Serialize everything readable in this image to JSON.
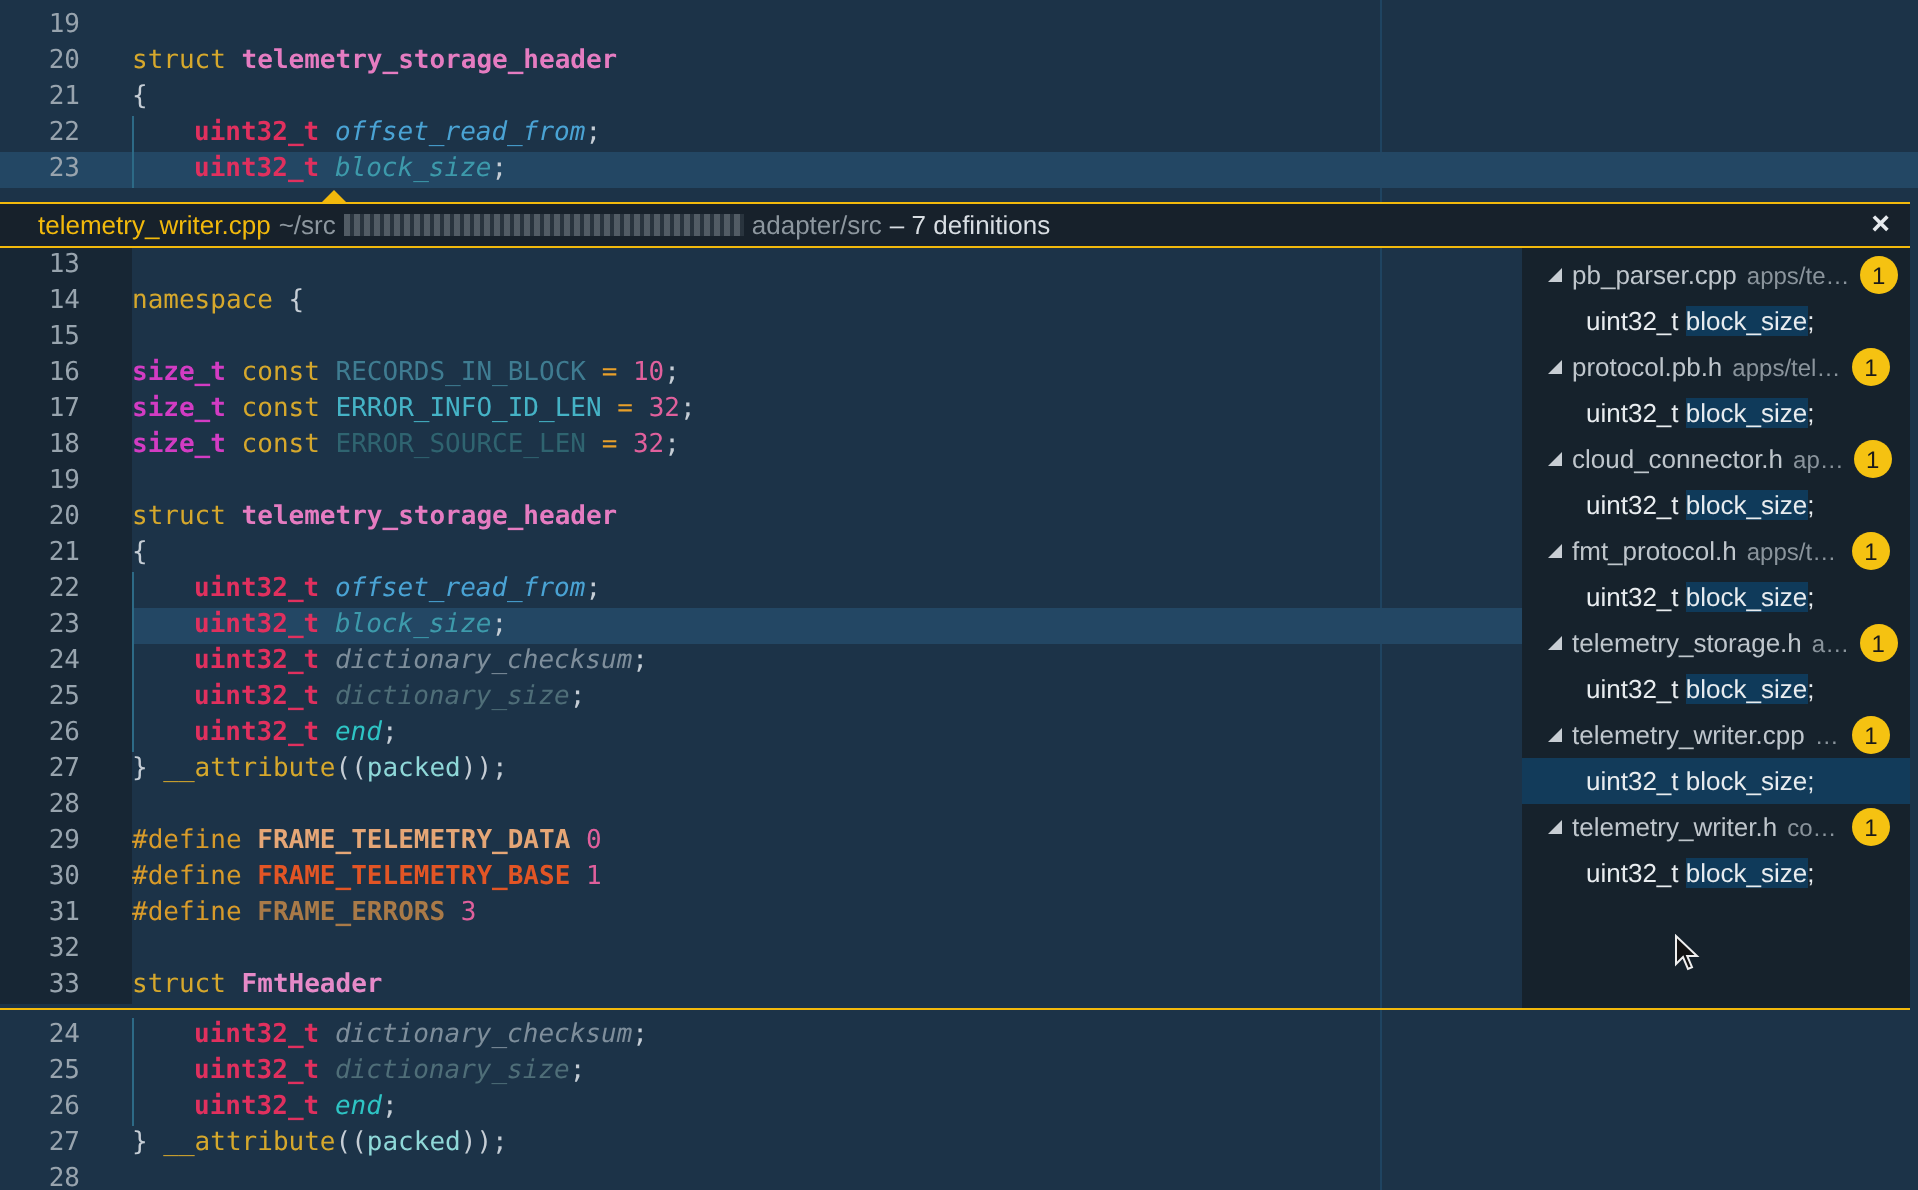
{
  "top_editor": {
    "lines": [
      {
        "number": "19",
        "current": false,
        "indented": false
      },
      {
        "number": "20",
        "current": false,
        "indented": false,
        "tokens": [
          {
            "text": "struct ",
            "color": "#d6a82c",
            "kind": "plain"
          },
          {
            "text": "telemetry_storage_header",
            "color": "#e57cc1",
            "kind": "bold"
          }
        ]
      },
      {
        "number": "21",
        "current": false,
        "indented": false,
        "tokens": [
          {
            "text": "{",
            "color": "#c5cdd5",
            "kind": "plain"
          }
        ]
      },
      {
        "number": "22",
        "current": false,
        "indented": true,
        "tokens": [
          {
            "text": "uint32_t ",
            "color": "#e0305e",
            "kind": "bold"
          },
          {
            "text": "offset_read_from",
            "color": "#4aa3d4",
            "kind": "italic"
          },
          {
            "text": ";",
            "color": "#c5cdd5",
            "kind": "plain"
          }
        ]
      },
      {
        "number": "23",
        "current": true,
        "indented": true,
        "tokens": [
          {
            "text": "uint32_t ",
            "color": "#e0305e",
            "kind": "bold"
          },
          {
            "text": "block_size",
            "color": "#3d9aab",
            "kind": "italic"
          },
          {
            "text": ";",
            "color": "#c5cdd5",
            "kind": "plain"
          }
        ]
      }
    ]
  },
  "peek": {
    "file": "telemetry_writer.cpp",
    "path_start": "~/src",
    "path_end": "adapter/src",
    "summary": "– 7 definitions",
    "close": "×",
    "lines": [
      {
        "number": "13",
        "current": false,
        "indented": false
      },
      {
        "number": "14",
        "current": false,
        "indented": false,
        "tokens": [
          {
            "text": "namespace ",
            "color": "#d6a82c",
            "kind": "plain"
          },
          {
            "text": "{",
            "color": "#c5cdd5",
            "kind": "plain"
          }
        ]
      },
      {
        "number": "15",
        "current": false,
        "indented": false
      },
      {
        "number": "16",
        "current": false,
        "indented": false,
        "tokens": [
          {
            "text": "size_t ",
            "color": "#d23cc3",
            "kind": "bold"
          },
          {
            "text": "const ",
            "color": "#d6a82c",
            "kind": "plain"
          },
          {
            "text": "RECORDS_IN_BLOCK ",
            "color": "#3f7c91",
            "kind": "plain"
          },
          {
            "text": "= ",
            "color": "#e8a02a",
            "kind": "plain"
          },
          {
            "text": "10",
            "color": "#e0609c",
            "kind": "plain"
          },
          {
            "text": ";",
            "color": "#c5cdd5",
            "kind": "plain"
          }
        ]
      },
      {
        "number": "17",
        "current": false,
        "indented": false,
        "tokens": [
          {
            "text": "size_t ",
            "color": "#d23cc3",
            "kind": "bold"
          },
          {
            "text": "const ",
            "color": "#d6a82c",
            "kind": "plain"
          },
          {
            "text": "ERROR_INFO_ID_LEN ",
            "color": "#45b3c6",
            "kind": "plain"
          },
          {
            "text": "= ",
            "color": "#e8a02a",
            "kind": "plain"
          },
          {
            "text": "32",
            "color": "#e0609c",
            "kind": "plain"
          },
          {
            "text": ";",
            "color": "#c5cdd5",
            "kind": "plain"
          }
        ]
      },
      {
        "number": "18",
        "current": false,
        "indented": false,
        "tokens": [
          {
            "text": "size_t ",
            "color": "#d23cc3",
            "kind": "bold"
          },
          {
            "text": "const ",
            "color": "#d6a82c",
            "kind": "plain"
          },
          {
            "text": "ERROR_SOURCE_LEN ",
            "color": "#2f6470",
            "kind": "plain"
          },
          {
            "text": "= ",
            "color": "#e8a02a",
            "kind": "plain"
          },
          {
            "text": "32",
            "color": "#e0609c",
            "kind": "plain"
          },
          {
            "text": ";",
            "color": "#c5cdd5",
            "kind": "plain"
          }
        ]
      },
      {
        "number": "19",
        "current": false,
        "indented": false
      },
      {
        "number": "20",
        "current": false,
        "indented": false,
        "tokens": [
          {
            "text": "struct ",
            "color": "#d6a82c",
            "kind": "plain"
          },
          {
            "text": "telemetry_storage_header",
            "color": "#e57cc1",
            "kind": "bold"
          }
        ]
      },
      {
        "number": "21",
        "current": false,
        "indented": false,
        "tokens": [
          {
            "text": "{",
            "color": "#c5cdd5",
            "kind": "plain"
          }
        ]
      },
      {
        "number": "22",
        "current": false,
        "indented": true,
        "tokens": [
          {
            "text": "uint32_t ",
            "color": "#e0305e",
            "kind": "bold"
          },
          {
            "text": "offset_read_from",
            "color": "#4aa3d4",
            "kind": "italic"
          },
          {
            "text": ";",
            "color": "#c5cdd5",
            "kind": "plain"
          }
        ]
      },
      {
        "number": "23",
        "current": true,
        "indented": true,
        "tokens": [
          {
            "text": "uint32_t ",
            "color": "#e0305e",
            "kind": "bold"
          },
          {
            "text": "block_size",
            "color": "#3d9aab",
            "kind": "italic"
          },
          {
            "text": ";",
            "color": "#c5cdd5",
            "kind": "plain"
          }
        ]
      },
      {
        "number": "24",
        "current": false,
        "indented": true,
        "tokens": [
          {
            "text": "uint32_t ",
            "color": "#e0305e",
            "kind": "bold"
          },
          {
            "text": "dictionary_checksum",
            "color": "#7e8e9b",
            "kind": "italic"
          },
          {
            "text": ";",
            "color": "#c5cdd5",
            "kind": "plain"
          }
        ]
      },
      {
        "number": "25",
        "current": false,
        "indented": true,
        "tokens": [
          {
            "text": "uint32_t ",
            "color": "#e0305e",
            "kind": "bold"
          },
          {
            "text": "dictionary_size",
            "color": "#4f6e78",
            "kind": "italic"
          },
          {
            "text": ";",
            "color": "#c5cdd5",
            "kind": "plain"
          }
        ]
      },
      {
        "number": "26",
        "current": false,
        "indented": true,
        "tokens": [
          {
            "text": "uint32_t ",
            "color": "#e0305e",
            "kind": "bold"
          },
          {
            "text": "end",
            "color": "#2ec4c4",
            "kind": "italic"
          },
          {
            "text": ";",
            "color": "#c5cdd5",
            "kind": "plain"
          }
        ]
      },
      {
        "number": "27",
        "current": false,
        "indented": false,
        "tokens": [
          {
            "text": "} ",
            "color": "#c5cdd5",
            "kind": "plain"
          },
          {
            "text": "__attribute",
            "color": "#d6a82c",
            "kind": "plain"
          },
          {
            "text": "((",
            "color": "#c5cdd5",
            "kind": "plain"
          },
          {
            "text": "packed",
            "color": "#8fd8d8",
            "kind": "plain"
          },
          {
            "text": "));",
            "color": "#c5cdd5",
            "kind": "plain"
          }
        ]
      },
      {
        "number": "28",
        "current": false,
        "indented": false
      },
      {
        "number": "29",
        "current": false,
        "indented": false,
        "tokens": [
          {
            "text": "#define ",
            "color": "#d89b2a",
            "kind": "plain"
          },
          {
            "text": "FRAME_TELEMETRY_DATA ",
            "color": "#e5a676",
            "kind": "bold"
          },
          {
            "text": "0",
            "color": "#e0609c",
            "kind": "plain"
          }
        ]
      },
      {
        "number": "30",
        "current": false,
        "indented": false,
        "tokens": [
          {
            "text": "#define ",
            "color": "#d89b2a",
            "kind": "plain"
          },
          {
            "text": "FRAME_TELEMETRY_BASE ",
            "color": "#e25525",
            "kind": "bold"
          },
          {
            "text": "1",
            "color": "#e0609c",
            "kind": "plain"
          }
        ]
      },
      {
        "number": "31",
        "current": false,
        "indented": false,
        "tokens": [
          {
            "text": "#define ",
            "color": "#d89b2a",
            "kind": "plain"
          },
          {
            "text": "FRAME_ERRORS ",
            "color": "#a97a48",
            "kind": "bold"
          },
          {
            "text": "3",
            "color": "#e0609c",
            "kind": "plain"
          }
        ]
      },
      {
        "number": "32",
        "current": false,
        "indented": false
      },
      {
        "number": "33",
        "current": false,
        "indented": false,
        "tokens": [
          {
            "text": "struct ",
            "color": "#d6a82c",
            "kind": "plain"
          },
          {
            "text": "FmtHeader",
            "color": "#e68ac8",
            "kind": "bold"
          }
        ]
      }
    ],
    "references": [
      {
        "file": "pb_parser.cpp",
        "path": "apps/te…",
        "count": "1",
        "expanded": true,
        "children": [
          {
            "prefix": "uint32_t",
            "match": "block_size",
            "suffix": ";",
            "selected": false
          }
        ]
      },
      {
        "file": "protocol.pb.h",
        "path": "apps/tel…",
        "count": "1",
        "expanded": true,
        "children": [
          {
            "prefix": "uint32_t",
            "match": "block_size",
            "suffix": ";",
            "selected": false
          }
        ]
      },
      {
        "file": "cloud_connector.h",
        "path": "ap…",
        "count": "1",
        "expanded": true,
        "children": [
          {
            "prefix": "uint32_t",
            "match": "block_size",
            "suffix": ";",
            "selected": false
          }
        ]
      },
      {
        "file": "fmt_protocol.h",
        "path": "apps/t…",
        "count": "1",
        "expanded": true,
        "children": [
          {
            "prefix": "uint32_t",
            "match": "block_size",
            "suffix": ";",
            "selected": false
          }
        ]
      },
      {
        "file": "telemetry_storage.h",
        "path": "a…",
        "count": "1",
        "expanded": true,
        "children": [
          {
            "prefix": "uint32_t",
            "match": "block_size",
            "suffix": ";",
            "selected": false
          }
        ]
      },
      {
        "file": "telemetry_writer.cpp",
        "path": "…",
        "count": "1",
        "expanded": true,
        "children": [
          {
            "prefix": "uint32_t",
            "match": "block_size",
            "suffix": ";",
            "selected": true
          }
        ]
      },
      {
        "file": "telemetry_writer.h",
        "path": "co…",
        "count": "1",
        "expanded": true,
        "children": [
          {
            "prefix": "uint32_t",
            "match": "block_size",
            "suffix": ";",
            "selected": false
          }
        ]
      }
    ]
  },
  "bottom_editor": {
    "lines": [
      {
        "number": "24",
        "current": false,
        "indented": true,
        "tokens": [
          {
            "text": "uint32_t ",
            "color": "#e0305e",
            "kind": "bold"
          },
          {
            "text": "dictionary_checksum",
            "color": "#7e8e9b",
            "kind": "italic"
          },
          {
            "text": ";",
            "color": "#c5cdd5",
            "kind": "plain"
          }
        ]
      },
      {
        "number": "25",
        "current": false,
        "indented": true,
        "tokens": [
          {
            "text": "uint32_t ",
            "color": "#e0305e",
            "kind": "bold"
          },
          {
            "text": "dictionary_size",
            "color": "#4f6e78",
            "kind": "italic"
          },
          {
            "text": ";",
            "color": "#c5cdd5",
            "kind": "plain"
          }
        ]
      },
      {
        "number": "26",
        "current": false,
        "indented": true,
        "tokens": [
          {
            "text": "uint32_t ",
            "color": "#e0305e",
            "kind": "bold"
          },
          {
            "text": "end",
            "color": "#2ec4c4",
            "kind": "italic"
          },
          {
            "text": ";",
            "color": "#c5cdd5",
            "kind": "plain"
          }
        ]
      },
      {
        "number": "27",
        "current": false,
        "indented": false,
        "tokens": [
          {
            "text": "} ",
            "color": "#c5cdd5",
            "kind": "plain"
          },
          {
            "text": "__attribute",
            "color": "#d6a82c",
            "kind": "plain"
          },
          {
            "text": "((",
            "color": "#c5cdd5",
            "kind": "plain"
          },
          {
            "text": "packed",
            "color": "#8fd8d8",
            "kind": "plain"
          },
          {
            "text": "));",
            "color": "#c5cdd5",
            "kind": "plain"
          }
        ]
      },
      {
        "number": "28",
        "current": false,
        "indented": false
      }
    ]
  }
}
